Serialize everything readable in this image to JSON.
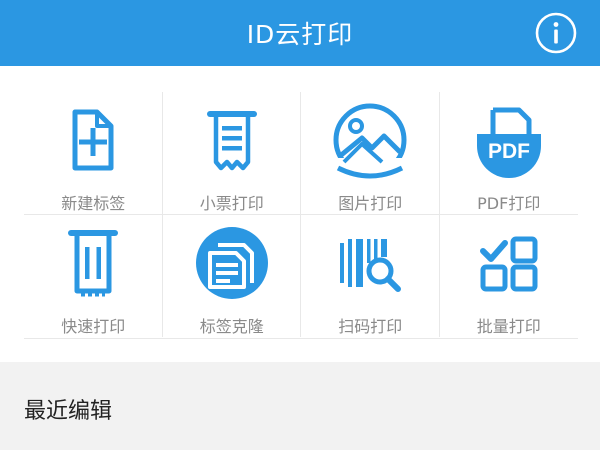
{
  "header": {
    "title": "ID云打印",
    "bg_color": "#2b97e2",
    "info_icon": "info-circle-icon"
  },
  "tiles": [
    {
      "label": "新建标签",
      "icon": "new-label-icon"
    },
    {
      "label": "小票打印",
      "icon": "receipt-icon"
    },
    {
      "label": "图片打印",
      "icon": "image-icon"
    },
    {
      "label": "PDF打印",
      "icon": "pdf-icon",
      "icon_text": "PDF"
    },
    {
      "label": "快速打印",
      "icon": "quick-print-icon"
    },
    {
      "label": "标签克隆",
      "icon": "clone-icon"
    },
    {
      "label": "扫码打印",
      "icon": "scan-icon"
    },
    {
      "label": "批量打印",
      "icon": "batch-icon"
    }
  ],
  "accent_color": "#2b97e2",
  "recent": {
    "title": "最近编辑"
  }
}
